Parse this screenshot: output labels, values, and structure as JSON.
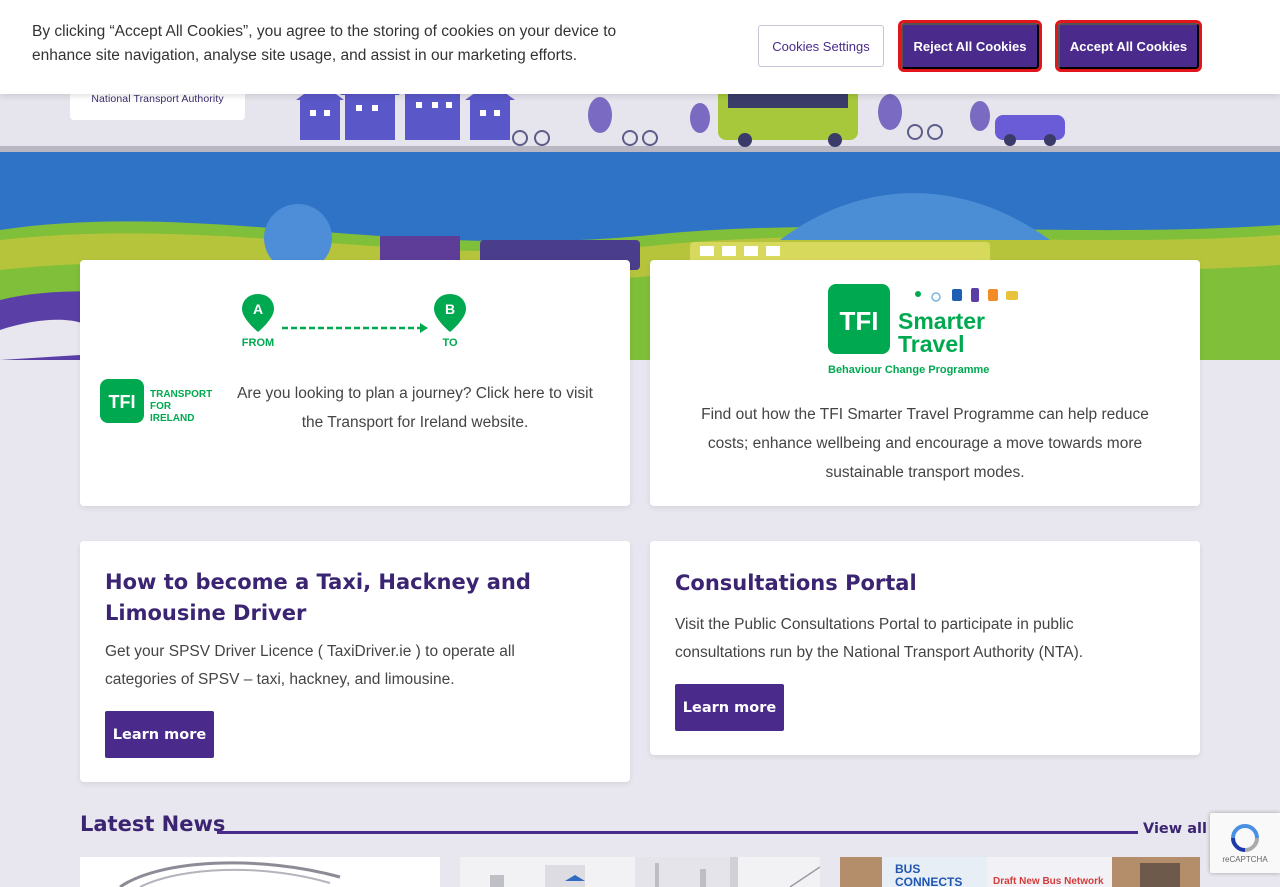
{
  "cookie_banner": {
    "message": "By clicking “Accept All Cookies”, you agree to the storing of cookies on your device to enhance site navigation, analyse site usage, and assist in our marketing efforts.",
    "settings_label": "Cookies Settings",
    "reject_label": "Reject All Cookies",
    "accept_label": "Accept All Cookies"
  },
  "header": {
    "logo_text": "National Transport Authority"
  },
  "journey_card": {
    "from_label": "FROM",
    "to_label": "TO",
    "a_label": "A",
    "b_label": "B",
    "tfi_logo": {
      "tfi": "TFI",
      "line1": "TRANSPORT",
      "line2": "FOR",
      "line3": "IRELAND"
    },
    "text": "Are you looking to plan a journey? Click here to visit the Transport for Ireland website."
  },
  "smarter_card": {
    "logo": {
      "tfi": "TFI",
      "line1": "Smarter",
      "line2": "Travel",
      "line3": "Behaviour Change Programme"
    },
    "text": "Find out how the TFI Smarter Travel Programme can help reduce costs; enhance wellbeing and encourage a move towards more sustainable transport modes."
  },
  "taxi_card": {
    "title": "How to become a Taxi, Hackney and Limousine Driver",
    "body": "Get your SPSV Driver Licence ( TaxiDriver.ie ) to operate all categories of SPSV – taxi, hackney, and limousine.",
    "button_label": "Learn more"
  },
  "consult_card": {
    "title": "Consultations Portal",
    "body": "Visit the Public Consultations Portal to participate in public consultations run by the National Transport Authority (NTA).",
    "button_label": "Learn more"
  },
  "news": {
    "heading": "Latest News",
    "view_all": "View all",
    "thumb3_text": {
      "line1": "BUS",
      "line2": "CONNECTS",
      "line3": "Draft New Bus Network"
    }
  },
  "recaptcha": {
    "label": "reCAPTCHA"
  },
  "colors": {
    "brand_purple": "#4a2b8c",
    "tfi_green": "#00a94f",
    "alert_red": "#e0161c"
  }
}
